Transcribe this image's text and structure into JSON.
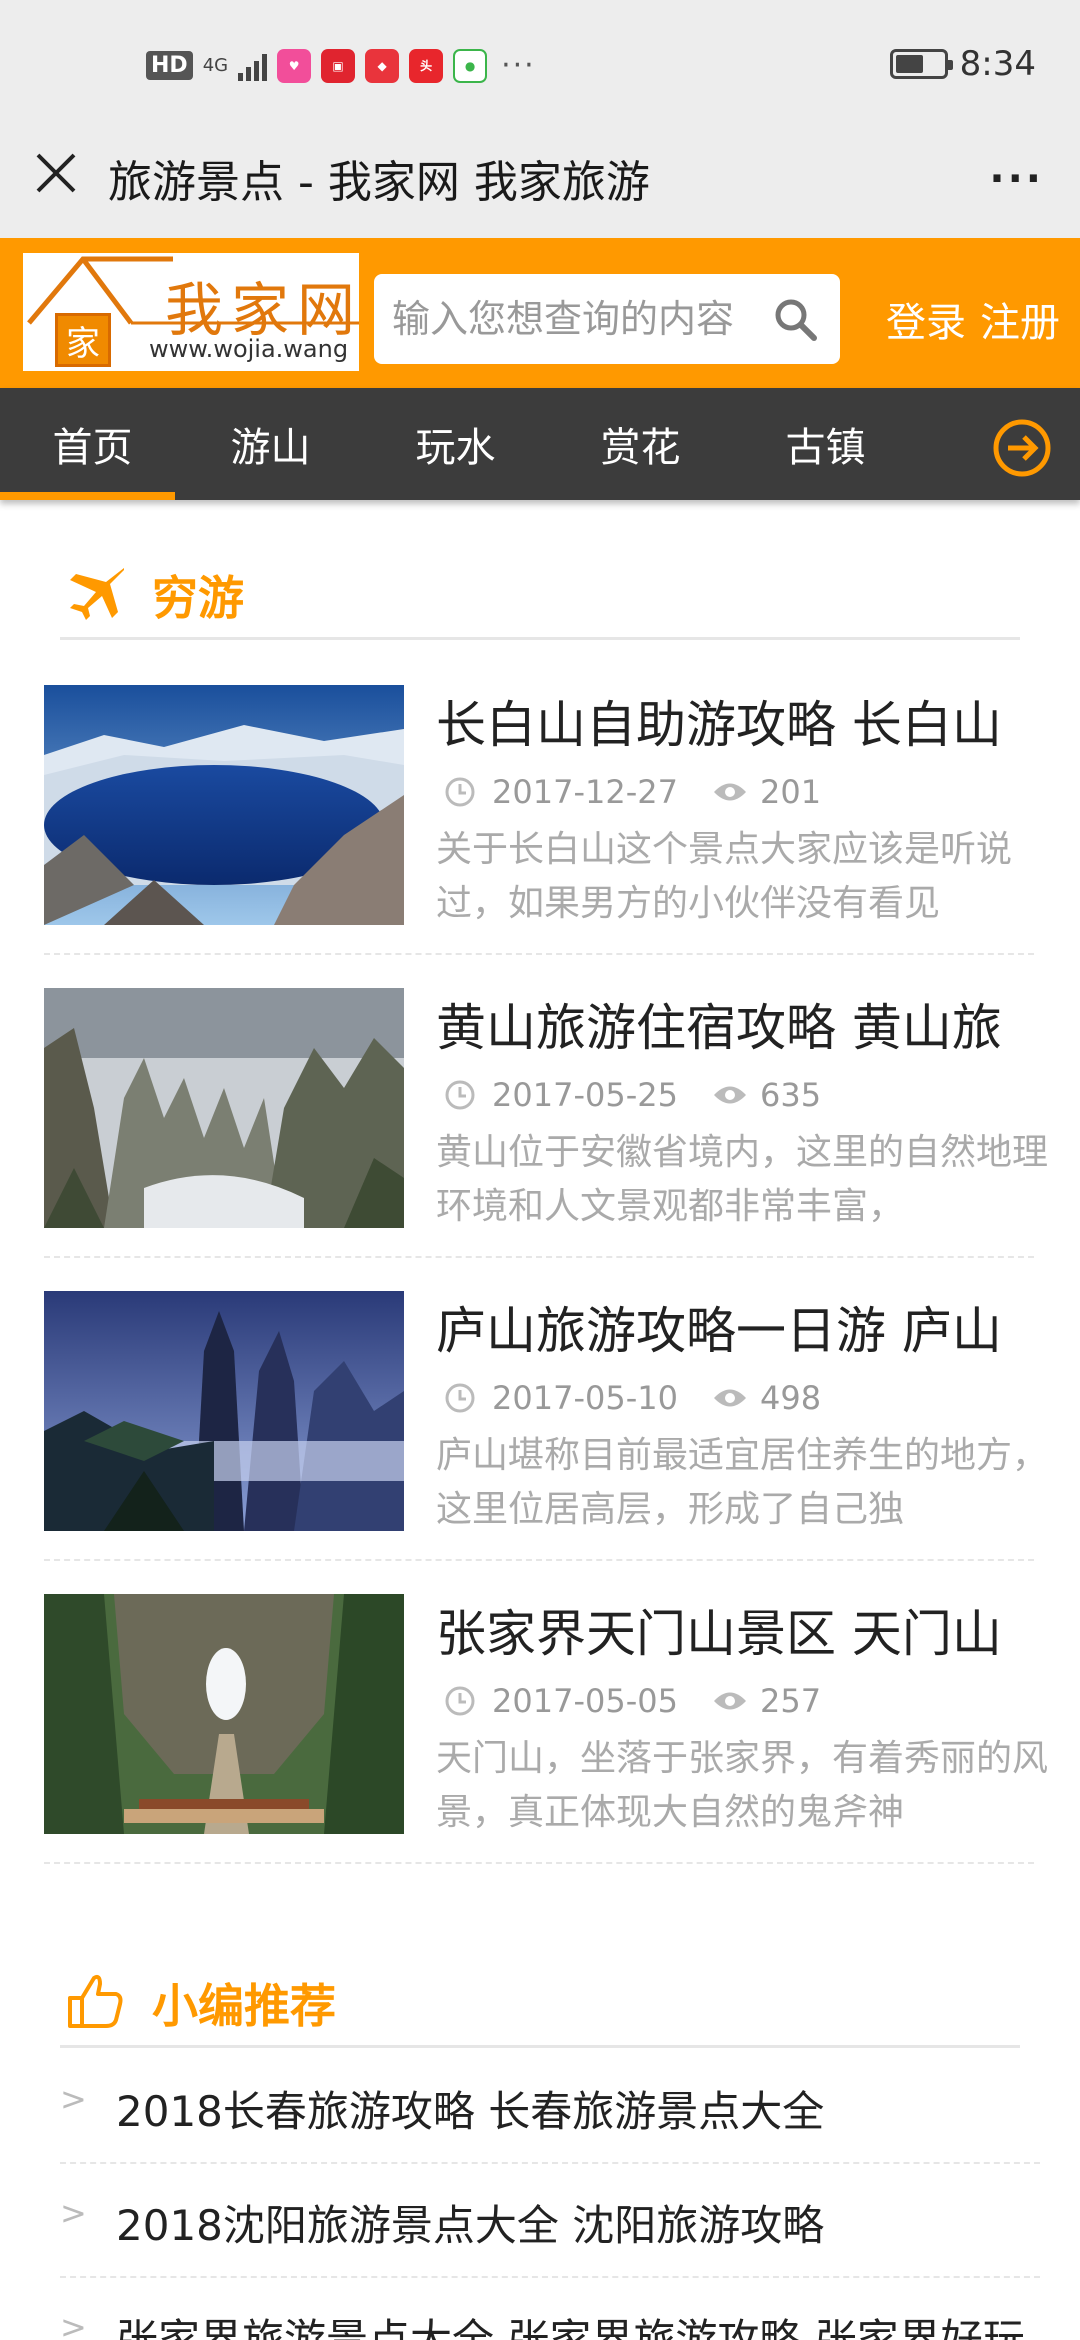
{
  "status_bar": {
    "network": "HD",
    "signal": "4G",
    "more": "···",
    "time": "8:34"
  },
  "title_bar": {
    "title": "旅游景点 - 我家网 我家旅游",
    "more": "···"
  },
  "header": {
    "logo_text": "我家网",
    "logo_url": "www.wojia.wang",
    "logo_char": "家",
    "search_placeholder": "输入您想查询的内容",
    "login": "登录",
    "register": "注册"
  },
  "nav": {
    "items": [
      "首页",
      "游山",
      "玩水",
      "赏花",
      "古镇"
    ]
  },
  "section1": {
    "title": "穷游"
  },
  "articles": [
    {
      "title": "长白山自助游攻略 长白山",
      "date": "2017-12-27",
      "views": "201",
      "desc": "关于长白山这个景点大家应该是听说过，如果男方的小伙伴没有看见"
    },
    {
      "title": "黄山旅游住宿攻略 黄山旅",
      "date": "2017-05-25",
      "views": "635",
      "desc": "黄山位于安徽省境内，这里的自然地理环境和人文景观都非常丰富，"
    },
    {
      "title": "庐山旅游攻略一日游 庐山",
      "date": "2017-05-10",
      "views": "498",
      "desc": "庐山堪称目前最适宜居住养生的地方，这里位居高层，形成了自己独"
    },
    {
      "title": "张家界天门山景区 天门山",
      "date": "2017-05-05",
      "views": "257",
      "desc": "天门山，坐落于张家界，有着秀丽的风景，真正体现大自然的鬼斧神"
    }
  ],
  "section2": {
    "title": "小编推荐"
  },
  "recommendations": [
    "2018长春旅游攻略 长春旅游景点大全",
    "2018沈阳旅游景点大全 沈阳旅游攻略",
    "张家界旅游景点大全 张家界旅游攻略 张家界好玩"
  ],
  "colors": {
    "accent": "#ff9900",
    "nav_bg": "#3c3c3c",
    "titlebar_bg": "#ededed"
  }
}
